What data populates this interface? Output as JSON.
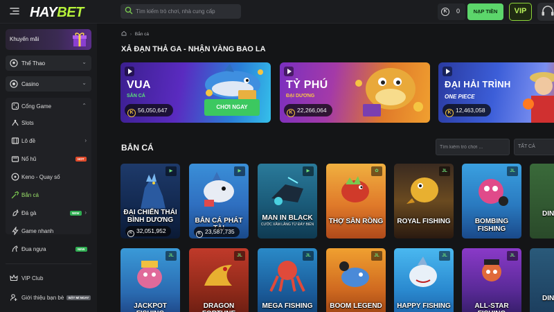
{
  "header": {
    "logo_part1": "HAY",
    "logo_part2": "BET",
    "search_placeholder": "Tìm kiếm trò chơi, nhà cung cấp",
    "balance": "0",
    "deposit_label": "NẠP TIỀN",
    "vip_label": "VIP"
  },
  "sidebar": {
    "promo_label": "Khuyến mãi",
    "items": [
      {
        "label": "Thể Thao",
        "icon": "soccer-ball-icon"
      },
      {
        "label": "Casino",
        "icon": "casino-chip-icon"
      }
    ],
    "group": {
      "label": "Cổng Game",
      "icon": "dice-icon",
      "items": [
        {
          "label": "Slots",
          "icon": "slot-machine-icon"
        },
        {
          "label": "Lô đề",
          "icon": "lottery-icon"
        },
        {
          "label": "Nổ hũ",
          "icon": "jackpot-icon",
          "badge": "HOT"
        },
        {
          "label": "Keno - Quay số",
          "icon": "keno-icon"
        },
        {
          "label": "Bắn cá",
          "icon": "fish-icon"
        },
        {
          "label": "Đá gà",
          "icon": "rooster-icon",
          "badge": "NEW"
        },
        {
          "label": "Game nhanh",
          "icon": "lightning-icon"
        },
        {
          "label": "Đua ngựa",
          "icon": "horse-icon",
          "badge": "NEW"
        }
      ]
    },
    "bottom": [
      {
        "label": "VIP Club",
        "icon": "crown-icon"
      },
      {
        "label": "Giới thiệu bạn bè",
        "icon": "refer-friend-icon",
        "badge": "BẬT MÍ NGAY"
      }
    ]
  },
  "main": {
    "breadcrumb": "Bắn cá",
    "promo_heading": "XẢ ĐẠN THẢ GA - NHẬN VÀNG BAO LA",
    "banners": [
      {
        "title": "VUA",
        "subtitle": "SĂN CÁ",
        "amount": "56,050,647",
        "button": "CHƠI NGAY"
      },
      {
        "title": "TỶ PHÚ",
        "subtitle": "ĐẠI DƯƠNG",
        "amount": "22,266,064"
      },
      {
        "title": "ĐẠI HẢI TRÌNH",
        "subtitle": "ONE PIECE",
        "amount": "12,463,058"
      }
    ],
    "games_heading": "BẮN CÁ",
    "filter_placeholder": "Tìm kiếm trò chơi ...",
    "filter_select": "TẤT CẢ",
    "games_row1": [
      {
        "name": "ĐẠI CHIẾN THÁI BÌNH DƯƠNG",
        "jackpot": "32,051,952",
        "provider": "play"
      },
      {
        "name": "BẮN CÁ PHÁT TÀI",
        "jackpot": "23,587,735",
        "provider": "play"
      },
      {
        "name": "MAN IN BLACK",
        "sub": "CƯỚC XÂM LĂNG TỪ ĐÁY BIỂN",
        "provider": "play"
      },
      {
        "name": "THỢ SĂN RỒNG",
        "provider": "paw"
      },
      {
        "name": "ROYAL FISHING",
        "provider": "JL"
      },
      {
        "name": "BOMBING FISHING",
        "provider": "JL"
      },
      {
        "name": "DING TYC",
        "provider": "JL"
      }
    ],
    "games_row2": [
      {
        "name": "JACKPOT FISHING",
        "provider": "JL"
      },
      {
        "name": "DRAGON FORTUNE",
        "provider": "JL"
      },
      {
        "name": "MEGA FISHING",
        "provider": "JL"
      },
      {
        "name": "BOOM LEGEND",
        "provider": "JL"
      },
      {
        "name": "HAPPY FISHING",
        "provider": "JL"
      },
      {
        "name": "ALL-STAR FISHING",
        "provider": "JL"
      },
      {
        "name": "DING TYC",
        "provider": "JL"
      }
    ]
  },
  "colors": {
    "accent_green": "#5cd66b",
    "vip_green": "#b9f25a",
    "background": "#141517",
    "sidebar": "#1a1b1e"
  }
}
